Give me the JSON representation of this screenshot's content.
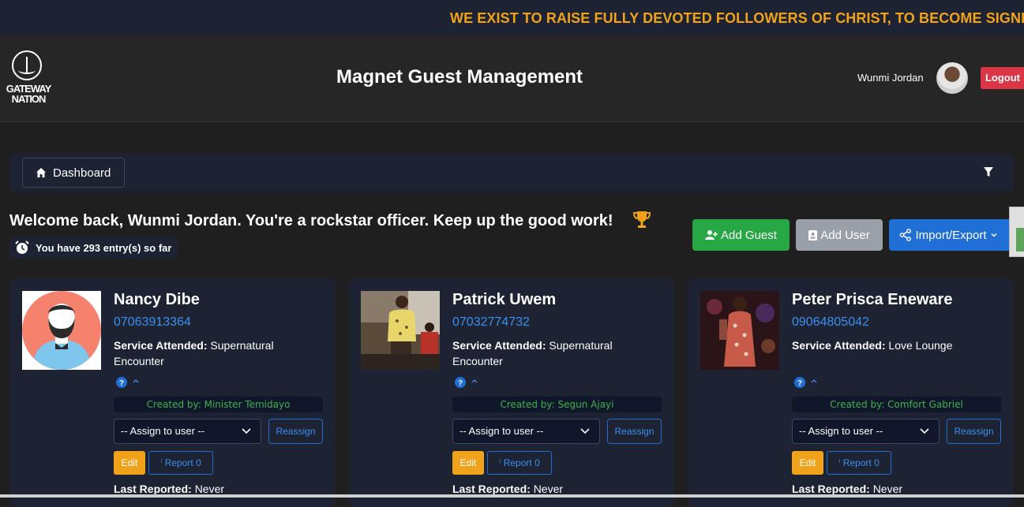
{
  "ticker": {
    "text": "WE EXIST TO RAISE FULLY DEVOTED FOLLOWERS OF CHRIST, TO BECOME SIGNIFICA"
  },
  "header": {
    "logo_line1": "GATEWAY",
    "logo_line2": "NATION",
    "title": "Magnet Guest Management",
    "username": "Wunmi Jordan",
    "logout_label": "Logout"
  },
  "breadcrumb": {
    "dashboard_label": "Dashboard"
  },
  "welcome": {
    "message": "Welcome back, Wunmi Jordan. You're a rockstar officer. Keep up the good work!",
    "entries": "You have 293 entry(s) so far"
  },
  "actions": {
    "add_guest": "Add Guest",
    "add_user": "Add User",
    "import_export": "Import/Export"
  },
  "colors": {
    "ticker_text": "#f0a31a",
    "link": "#3a8ff0",
    "success": "#28a745",
    "danger": "#dc3545",
    "warning": "#f0a31a"
  },
  "guests": [
    {
      "name": "Nancy Dibe",
      "phone": "07063913364",
      "service_label": "Service Attended:",
      "service": "Supernatural Encounter",
      "created_by": "Created by: Minister Temidayo",
      "assign_placeholder": "-- Assign to user --",
      "reassign": "Reassign",
      "edit": "Edit",
      "report": "Report 0",
      "last_reported_label": "Last Reported:",
      "last_reported": "Never"
    },
    {
      "name": "Patrick Uwem",
      "phone": "07032774732",
      "service_label": "Service Attended:",
      "service": "Supernatural Encounter",
      "created_by": "Created by: Segun Ajayi",
      "assign_placeholder": "-- Assign to user --",
      "reassign": "Reassign",
      "edit": "Edit",
      "report": "Report 0",
      "last_reported_label": "Last Reported:",
      "last_reported": "Never"
    },
    {
      "name": "Peter Prisca Eneware",
      "phone": "09064805042",
      "service_label": "Service Attended:",
      "service": "Love Lounge",
      "created_by": "Created by: Comfort Gabriel",
      "assign_placeholder": "-- Assign to user --",
      "reassign": "Reassign",
      "edit": "Edit",
      "report": "Report 0",
      "last_reported_label": "Last Reported:",
      "last_reported": "Never"
    }
  ]
}
